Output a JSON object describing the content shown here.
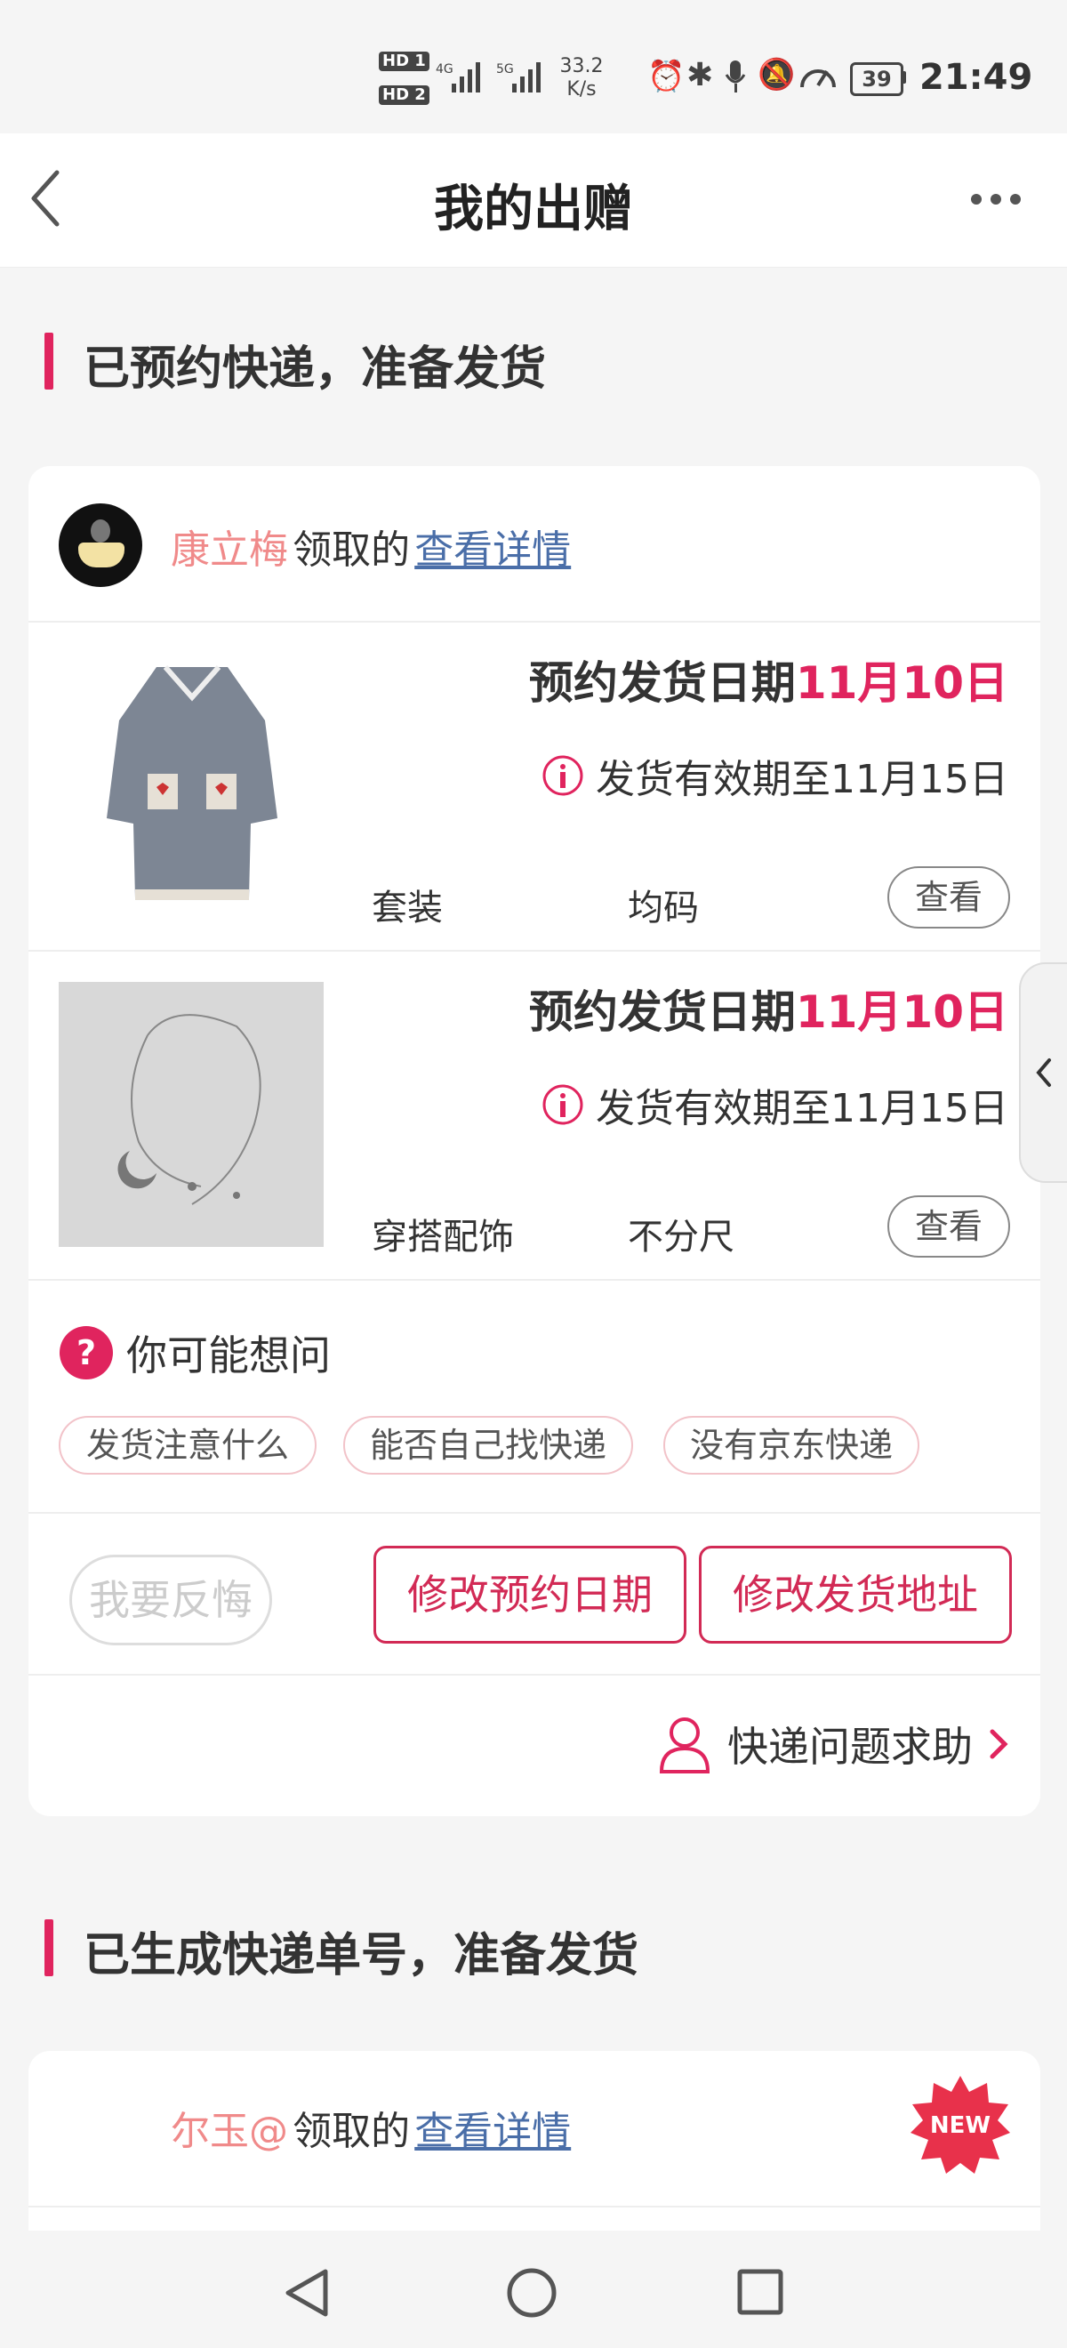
{
  "status_bar": {
    "sim1": "HD 1",
    "sim2": "HD 2",
    "net1": "4G",
    "net2": "5G",
    "speed_value": "33.2",
    "speed_unit": "K/s",
    "battery": "39",
    "time": "21:49"
  },
  "header": {
    "title": "我的出赠"
  },
  "section1": {
    "title": "已预约快递，准备发货",
    "card": {
      "user_name": "康立梅",
      "received_label": "领取的",
      "detail_link": "查看详情",
      "items": [
        {
          "date_label": "预约发货日期",
          "date_value": "11月10日",
          "valid_text": "发货有效期至11月15日",
          "category": "套装",
          "size": "均码",
          "view_label": "查看"
        },
        {
          "date_label": "预约发货日期",
          "date_value": "11月10日",
          "valid_text": "发货有效期至11月15日",
          "category": "穿搭配饰",
          "size": "不分尺",
          "view_label": "查看"
        }
      ],
      "faq_title": "你可能想问",
      "faq_chips": [
        "发货注意什么",
        "能否自己找快递",
        "没有京东快递"
      ],
      "regret_btn": "我要反悔",
      "modify_date_btn": "修改预约日期",
      "modify_address_btn": "修改发货地址",
      "help_link": "快递问题求助"
    }
  },
  "section2": {
    "title": "已生成快递单号，准备发货",
    "card": {
      "user_name": "尔玉@",
      "received_label": "领取的",
      "detail_link": "查看详情",
      "new_badge": "NEW"
    }
  },
  "colors": {
    "accent": "#e0245e",
    "link": "#4a6ea8",
    "name_pink": "#f08a8a"
  }
}
